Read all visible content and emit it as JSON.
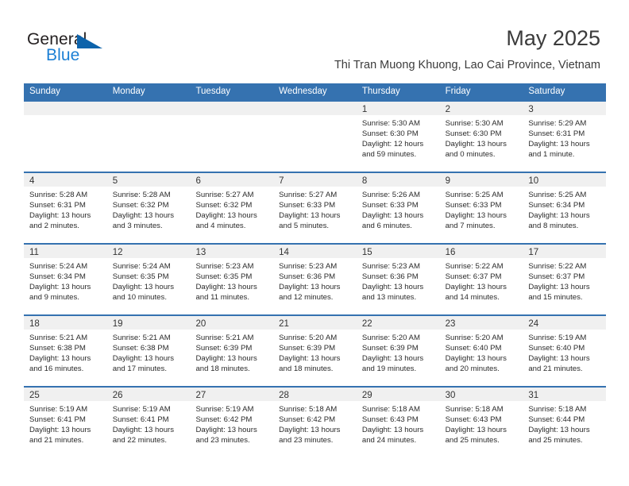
{
  "brand": {
    "word_one": "General",
    "word_two": "Blue",
    "triangle_color": "#0d63ab",
    "blue_text_color": "#1b7fd4"
  },
  "header": {
    "month_title": "May 2025",
    "location": "Thi Tran Muong Khuong, Lao Cai Province, Vietnam"
  },
  "theme": {
    "header_blue": "#3572b0",
    "day_band_gray": "#f0f0f0"
  },
  "calendar": {
    "weekdays": [
      "Sunday",
      "Monday",
      "Tuesday",
      "Wednesday",
      "Thursday",
      "Friday",
      "Saturday"
    ],
    "weeks": [
      [
        {
          "day": "",
          "sunrise": "",
          "sunset": "",
          "daylight_1": "",
          "daylight_2": ""
        },
        {
          "day": "",
          "sunrise": "",
          "sunset": "",
          "daylight_1": "",
          "daylight_2": ""
        },
        {
          "day": "",
          "sunrise": "",
          "sunset": "",
          "daylight_1": "",
          "daylight_2": ""
        },
        {
          "day": "",
          "sunrise": "",
          "sunset": "",
          "daylight_1": "",
          "daylight_2": ""
        },
        {
          "day": "1",
          "sunrise": "Sunrise: 5:30 AM",
          "sunset": "Sunset: 6:30 PM",
          "daylight_1": "Daylight: 12 hours",
          "daylight_2": "and 59 minutes."
        },
        {
          "day": "2",
          "sunrise": "Sunrise: 5:30 AM",
          "sunset": "Sunset: 6:30 PM",
          "daylight_1": "Daylight: 13 hours",
          "daylight_2": "and 0 minutes."
        },
        {
          "day": "3",
          "sunrise": "Sunrise: 5:29 AM",
          "sunset": "Sunset: 6:31 PM",
          "daylight_1": "Daylight: 13 hours",
          "daylight_2": "and 1 minute."
        }
      ],
      [
        {
          "day": "4",
          "sunrise": "Sunrise: 5:28 AM",
          "sunset": "Sunset: 6:31 PM",
          "daylight_1": "Daylight: 13 hours",
          "daylight_2": "and 2 minutes."
        },
        {
          "day": "5",
          "sunrise": "Sunrise: 5:28 AM",
          "sunset": "Sunset: 6:32 PM",
          "daylight_1": "Daylight: 13 hours",
          "daylight_2": "and 3 minutes."
        },
        {
          "day": "6",
          "sunrise": "Sunrise: 5:27 AM",
          "sunset": "Sunset: 6:32 PM",
          "daylight_1": "Daylight: 13 hours",
          "daylight_2": "and 4 minutes."
        },
        {
          "day": "7",
          "sunrise": "Sunrise: 5:27 AM",
          "sunset": "Sunset: 6:33 PM",
          "daylight_1": "Daylight: 13 hours",
          "daylight_2": "and 5 minutes."
        },
        {
          "day": "8",
          "sunrise": "Sunrise: 5:26 AM",
          "sunset": "Sunset: 6:33 PM",
          "daylight_1": "Daylight: 13 hours",
          "daylight_2": "and 6 minutes."
        },
        {
          "day": "9",
          "sunrise": "Sunrise: 5:25 AM",
          "sunset": "Sunset: 6:33 PM",
          "daylight_1": "Daylight: 13 hours",
          "daylight_2": "and 7 minutes."
        },
        {
          "day": "10",
          "sunrise": "Sunrise: 5:25 AM",
          "sunset": "Sunset: 6:34 PM",
          "daylight_1": "Daylight: 13 hours",
          "daylight_2": "and 8 minutes."
        }
      ],
      [
        {
          "day": "11",
          "sunrise": "Sunrise: 5:24 AM",
          "sunset": "Sunset: 6:34 PM",
          "daylight_1": "Daylight: 13 hours",
          "daylight_2": "and 9 minutes."
        },
        {
          "day": "12",
          "sunrise": "Sunrise: 5:24 AM",
          "sunset": "Sunset: 6:35 PM",
          "daylight_1": "Daylight: 13 hours",
          "daylight_2": "and 10 minutes."
        },
        {
          "day": "13",
          "sunrise": "Sunrise: 5:23 AM",
          "sunset": "Sunset: 6:35 PM",
          "daylight_1": "Daylight: 13 hours",
          "daylight_2": "and 11 minutes."
        },
        {
          "day": "14",
          "sunrise": "Sunrise: 5:23 AM",
          "sunset": "Sunset: 6:36 PM",
          "daylight_1": "Daylight: 13 hours",
          "daylight_2": "and 12 minutes."
        },
        {
          "day": "15",
          "sunrise": "Sunrise: 5:23 AM",
          "sunset": "Sunset: 6:36 PM",
          "daylight_1": "Daylight: 13 hours",
          "daylight_2": "and 13 minutes."
        },
        {
          "day": "16",
          "sunrise": "Sunrise: 5:22 AM",
          "sunset": "Sunset: 6:37 PM",
          "daylight_1": "Daylight: 13 hours",
          "daylight_2": "and 14 minutes."
        },
        {
          "day": "17",
          "sunrise": "Sunrise: 5:22 AM",
          "sunset": "Sunset: 6:37 PM",
          "daylight_1": "Daylight: 13 hours",
          "daylight_2": "and 15 minutes."
        }
      ],
      [
        {
          "day": "18",
          "sunrise": "Sunrise: 5:21 AM",
          "sunset": "Sunset: 6:38 PM",
          "daylight_1": "Daylight: 13 hours",
          "daylight_2": "and 16 minutes."
        },
        {
          "day": "19",
          "sunrise": "Sunrise: 5:21 AM",
          "sunset": "Sunset: 6:38 PM",
          "daylight_1": "Daylight: 13 hours",
          "daylight_2": "and 17 minutes."
        },
        {
          "day": "20",
          "sunrise": "Sunrise: 5:21 AM",
          "sunset": "Sunset: 6:39 PM",
          "daylight_1": "Daylight: 13 hours",
          "daylight_2": "and 18 minutes."
        },
        {
          "day": "21",
          "sunrise": "Sunrise: 5:20 AM",
          "sunset": "Sunset: 6:39 PM",
          "daylight_1": "Daylight: 13 hours",
          "daylight_2": "and 18 minutes."
        },
        {
          "day": "22",
          "sunrise": "Sunrise: 5:20 AM",
          "sunset": "Sunset: 6:39 PM",
          "daylight_1": "Daylight: 13 hours",
          "daylight_2": "and 19 minutes."
        },
        {
          "day": "23",
          "sunrise": "Sunrise: 5:20 AM",
          "sunset": "Sunset: 6:40 PM",
          "daylight_1": "Daylight: 13 hours",
          "daylight_2": "and 20 minutes."
        },
        {
          "day": "24",
          "sunrise": "Sunrise: 5:19 AM",
          "sunset": "Sunset: 6:40 PM",
          "daylight_1": "Daylight: 13 hours",
          "daylight_2": "and 21 minutes."
        }
      ],
      [
        {
          "day": "25",
          "sunrise": "Sunrise: 5:19 AM",
          "sunset": "Sunset: 6:41 PM",
          "daylight_1": "Daylight: 13 hours",
          "daylight_2": "and 21 minutes."
        },
        {
          "day": "26",
          "sunrise": "Sunrise: 5:19 AM",
          "sunset": "Sunset: 6:41 PM",
          "daylight_1": "Daylight: 13 hours",
          "daylight_2": "and 22 minutes."
        },
        {
          "day": "27",
          "sunrise": "Sunrise: 5:19 AM",
          "sunset": "Sunset: 6:42 PM",
          "daylight_1": "Daylight: 13 hours",
          "daylight_2": "and 23 minutes."
        },
        {
          "day": "28",
          "sunrise": "Sunrise: 5:18 AM",
          "sunset": "Sunset: 6:42 PM",
          "daylight_1": "Daylight: 13 hours",
          "daylight_2": "and 23 minutes."
        },
        {
          "day": "29",
          "sunrise": "Sunrise: 5:18 AM",
          "sunset": "Sunset: 6:43 PM",
          "daylight_1": "Daylight: 13 hours",
          "daylight_2": "and 24 minutes."
        },
        {
          "day": "30",
          "sunrise": "Sunrise: 5:18 AM",
          "sunset": "Sunset: 6:43 PM",
          "daylight_1": "Daylight: 13 hours",
          "daylight_2": "and 25 minutes."
        },
        {
          "day": "31",
          "sunrise": "Sunrise: 5:18 AM",
          "sunset": "Sunset: 6:44 PM",
          "daylight_1": "Daylight: 13 hours",
          "daylight_2": "and 25 minutes."
        }
      ]
    ]
  }
}
